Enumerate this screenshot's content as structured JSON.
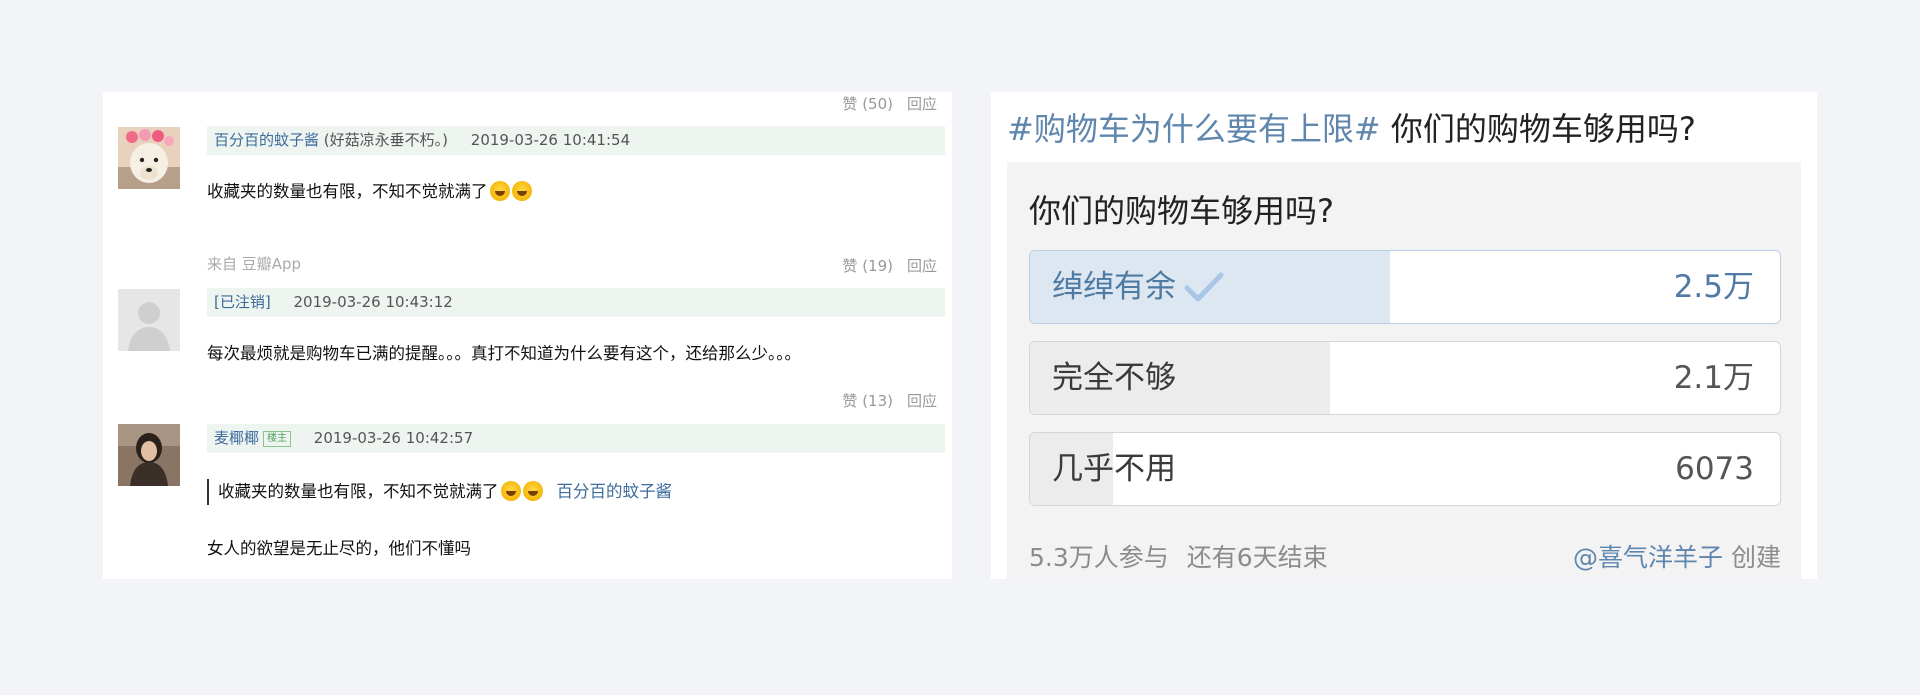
{
  "comments": [
    {
      "vote": "赞 (50)",
      "reply": "回应",
      "author": "百分百的蚊子酱",
      "note": "(好菇凉永垂不朽。)",
      "time": "2019-03-26 10:41:54",
      "text": "收藏夹的数量也有限，不知不觉就满了"
    },
    {
      "from": "来自 豆瓣App",
      "vote": "赞 (19)",
      "reply": "回应",
      "author": "[已注销]",
      "time": "2019-03-26 10:43:12",
      "text": "每次最烦就是购物车已满的提醒。。。真打不知道为什么要有这个，还给那么少。。。"
    },
    {
      "vote": "赞 (13)",
      "reply": "回应",
      "author": "麦椰椰",
      "badge": "楼主",
      "time": "2019-03-26 10:42:57",
      "quote_text": "收藏夹的数量也有限，不知不觉就满了",
      "quote_author": "百分百的蚊子酱",
      "text": "女人的欲望是无止尽的，他们不懂吗"
    }
  ],
  "poll": {
    "topic": "#购物车为什么要有上限#",
    "title": "你们的购物车够用吗?",
    "question": "你们的购物车够用吗?",
    "options": [
      {
        "label": "绰绰有余",
        "count": "2.5万",
        "share": 0.48,
        "selected": true
      },
      {
        "label": "完全不够",
        "count": "2.1万",
        "share": 0.4,
        "selected": false
      },
      {
        "label": "几乎不用",
        "count": "6073",
        "share": 0.11,
        "selected": false
      }
    ],
    "participants": "5.3万人参与",
    "remaining": "还有6天结束",
    "creator": "@喜气洋羊子",
    "created": "创建"
  },
  "colors": {
    "link": "#3c6b9c",
    "poll_accent": "#5f86ad",
    "meta_bg": "#eef4ef"
  },
  "icons": [
    "avatar-dog-flower",
    "avatar-default-user",
    "avatar-woman-photo",
    "laughing-tears-emoji",
    "check-icon"
  ]
}
